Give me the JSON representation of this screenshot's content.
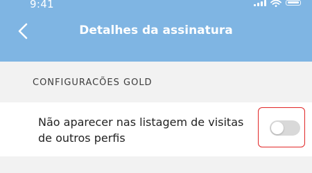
{
  "status_bar": {
    "time": "9:41"
  },
  "header": {
    "title": "Detalhes da assinatura",
    "background_color": "#7fb5e3"
  },
  "section": {
    "label": "CONFIGURACÕES GOLD"
  },
  "setting": {
    "label": "Não aparecer nas listagem de visitas de outros perfis",
    "toggle_on": false
  },
  "colors": {
    "highlight": "#e12626",
    "toggle_off": "#d9d9d9"
  }
}
